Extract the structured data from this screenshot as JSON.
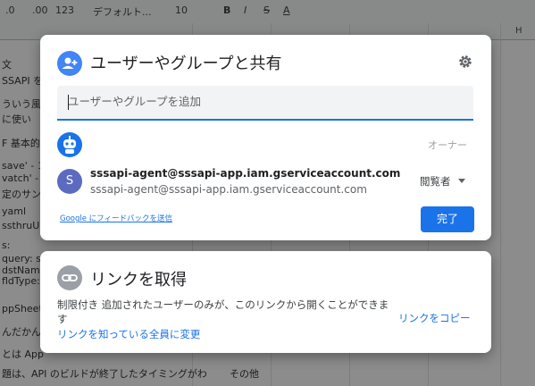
{
  "toolbar": {
    "decimal_decrease": ".0",
    "decimal_increase": ".00",
    "number_format": "123",
    "font_name": "デフォルト...",
    "font_size": "10",
    "bold": "B",
    "italic": "I",
    "strike": "S",
    "text_color": "A"
  },
  "sheet": {
    "column_h": "H",
    "rows": [
      "文",
      "SSAPI を",
      "ういう風",
      "に使い",
      "F 基本的な",
      "save' - コ",
      "vatch' - ",
      "定のサン",
      "yaml",
      "ssthruUn",
      "s:",
      "query: sl",
      "dstName",
      "fldType: i",
      "ppSheet の",
      "んだかん",
      "とは App",
      "題は、API のビルドが終了したタイミングがわ",
      "その他"
    ]
  },
  "share_dialog": {
    "title": "ユーザーやグループと共有",
    "input_placeholder": "ユーザーやグループを追加",
    "owner_label": "オーナー",
    "user_initial": "S",
    "user_email": "sssapi-agent@sssapi-app.iam.gserviceaccount.com",
    "user_email_secondary": "sssapi-agent@sssapi-app.iam.gserviceaccount.com",
    "role_label": "閲覧者",
    "feedback_link": "Google にフィードバックを送信",
    "done_button": "完了"
  },
  "link_dialog": {
    "title": "リンクを取得",
    "description": "制限付き 追加されたユーザーのみが、このリンクから開くことができます",
    "change_link": "リンクを知っている全員に変更",
    "copy_link": "リンクをコピー"
  },
  "icons": {
    "share": "person-add-icon",
    "settings": "gear-icon",
    "link": "link-icon",
    "dropdown": "chevron-down-icon"
  },
  "colors": {
    "accent": "#1a73e8",
    "share_icon_bg": "#4285f4",
    "avatar_bg": "#5c6bc0"
  }
}
